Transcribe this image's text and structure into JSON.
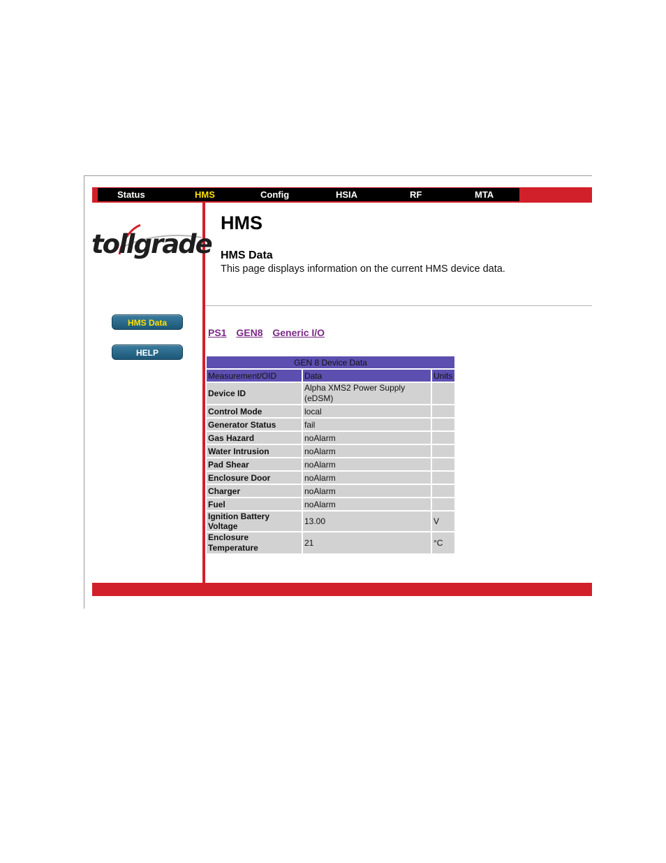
{
  "nav": [
    {
      "label": "Status",
      "active": false
    },
    {
      "label": "HMS",
      "active": true
    },
    {
      "label": "Config",
      "active": false
    },
    {
      "label": "HSIA",
      "active": false
    },
    {
      "label": "RF",
      "active": false
    },
    {
      "label": "MTA",
      "active": false
    }
  ],
  "logo": {
    "text": "tollgrade"
  },
  "sidebar": [
    {
      "label": "HMS Data",
      "active": true
    },
    {
      "label": "HELP",
      "active": false
    }
  ],
  "page": {
    "title": "HMS",
    "section_title": "HMS Data",
    "description": "This page displays information on the current HMS device data."
  },
  "sub_links": [
    "PS1",
    "GEN8",
    "Generic I/O"
  ],
  "table": {
    "caption": "GEN 8 Device Data",
    "headers": [
      "Measurement/OID",
      "Data",
      "Units"
    ],
    "rows": [
      {
        "label": "Device ID",
        "value": "Alpha XMS2 Power Supply (eDSM)",
        "unit": ""
      },
      {
        "label": "Control Mode",
        "value": "local",
        "unit": ""
      },
      {
        "label": "Generator Status",
        "value": "fail",
        "unit": ""
      },
      {
        "label": "Gas Hazard",
        "value": "noAlarm",
        "unit": ""
      },
      {
        "label": "Water Intrusion",
        "value": "noAlarm",
        "unit": ""
      },
      {
        "label": "Pad Shear",
        "value": "noAlarm",
        "unit": ""
      },
      {
        "label": "Enclosure Door",
        "value": "noAlarm",
        "unit": ""
      },
      {
        "label": "Charger",
        "value": "noAlarm",
        "unit": ""
      },
      {
        "label": "Fuel",
        "value": "noAlarm",
        "unit": ""
      },
      {
        "label": "Ignition Battery Voltage",
        "value": "13.00",
        "unit": "V"
      },
      {
        "label": "Enclosure Temperature",
        "value": "21",
        "unit": "°C"
      }
    ]
  },
  "colors": {
    "accent_red": "#d2202a",
    "nav_active": "#ffe000",
    "table_header": "#5c4fb0",
    "link": "#7a2a86"
  }
}
